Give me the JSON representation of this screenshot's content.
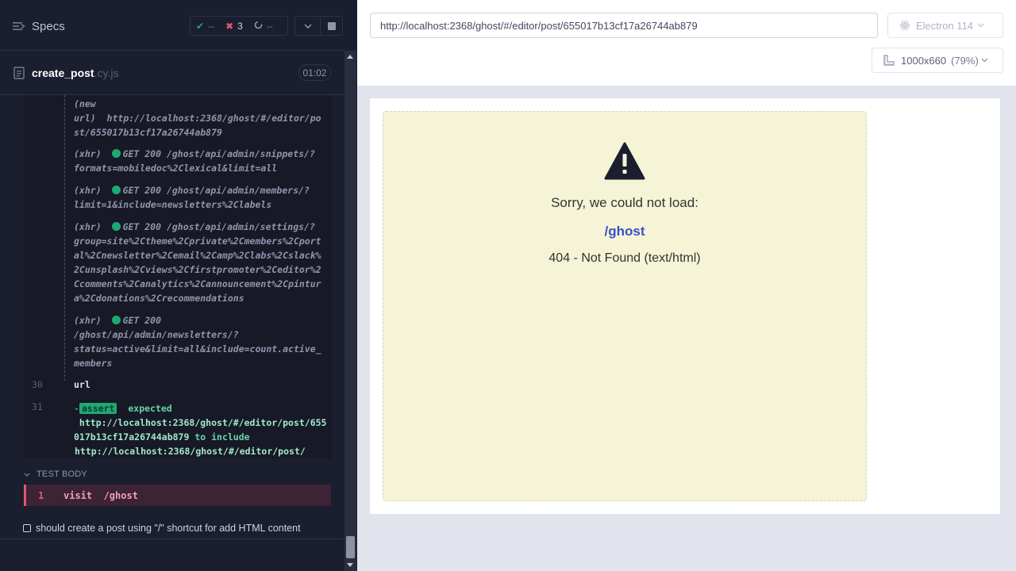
{
  "reporter": {
    "specs_label": "Specs",
    "stats": {
      "passed": "--",
      "failed": "3",
      "pending": "--"
    },
    "file": {
      "name": "create_post",
      "ext": ".cy.js",
      "duration": "01:02"
    },
    "log": [
      {
        "prefix": "(new",
        "text": "url)  http://localhost:2368/ghost/#/editor/post/655017b13cf17a26744ab879"
      },
      {
        "prefix": "(xhr)",
        "text": "GET 200 /ghost/api/admin/snippets/?formats=mobiledoc%2Clexical&limit=all"
      },
      {
        "prefix": "(xhr)",
        "text": "GET 200 /ghost/api/admin/members/?limit=1&include=newsletters%2Clabels"
      },
      {
        "prefix": "(xhr)",
        "text": "GET 200 /ghost/api/admin/settings/?group=site%2Ctheme%2Cprivate%2Cmembers%2Cportal%2Cnewsletter%2Cemail%2Camp%2Clabs%2Cslack%2Cunsplash%2Cviews%2Cfirstpromoter%2Ceditor%2Ccomments%2Canalytics%2Cannouncement%2Cpintura%2Cdonations%2Crecommendations"
      },
      {
        "prefix": "(xhr)",
        "text": "GET 200 /ghost/api/admin/newsletters/?status=active&limit=all&include=count.active_members"
      }
    ],
    "line30": {
      "num": "30",
      "cmd": "url"
    },
    "line31": {
      "num": "31",
      "dash": "-",
      "tag": "assert",
      "expected": "expected",
      "actual": "http://localhost:2368/ghost/#/editor/post/655017b13cf17a26744ab879",
      "to_include": "to include",
      "target": "http://localhost:2368/ghost/#/editor/post/"
    },
    "test_body": {
      "label": "TEST BODY",
      "fail_num": "1",
      "fail_cmd": "visit",
      "fail_arg": "/ghost"
    },
    "next_test": "should create a post using \"/\" shortcut for add HTML content"
  },
  "aut": {
    "url": "http://localhost:2368/ghost/#/editor/post/655017b13cf17a26744ab879",
    "browser": "Electron 114",
    "viewport": "1000x660",
    "scale": "(79%)",
    "error": {
      "message": "Sorry, we could not load:",
      "path": "/ghost",
      "status": "404 - Not Found (text/html)"
    }
  },
  "colors": {
    "accent_green": "#1fa971",
    "accent_red": "#e45770",
    "link_blue": "#3e4fc7"
  }
}
